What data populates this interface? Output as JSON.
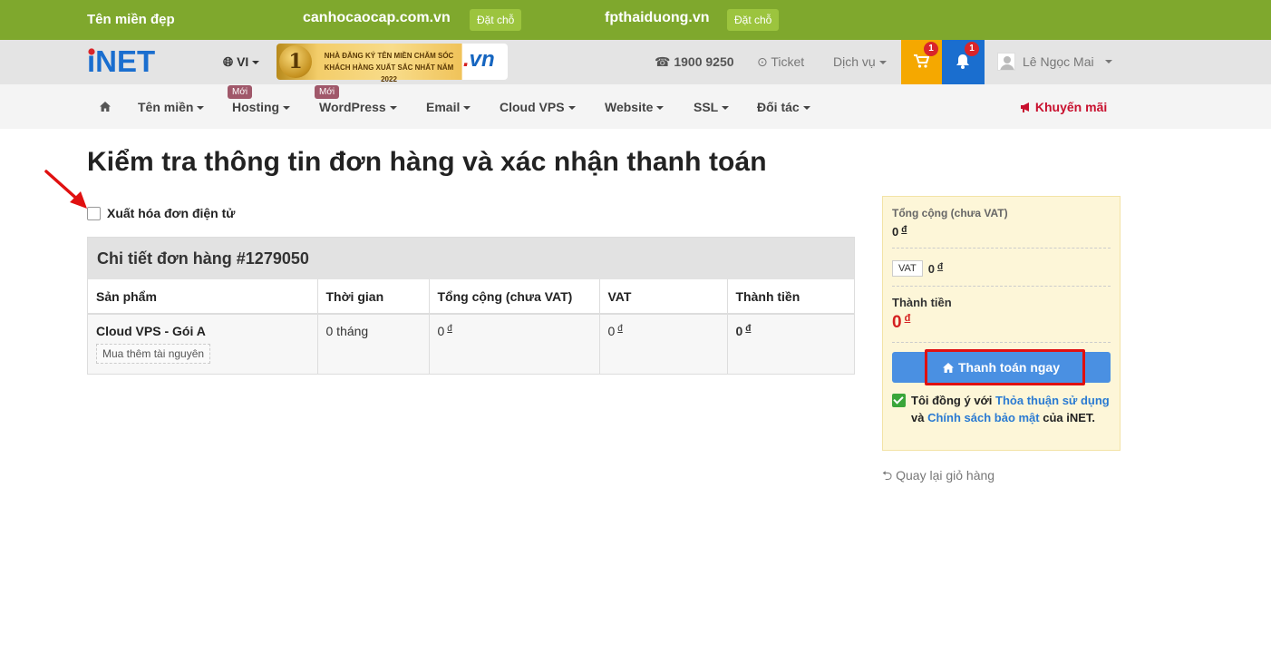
{
  "promo": {
    "title": "Tên miền đẹp",
    "domains": [
      {
        "name": "canhocaocap.com.vn",
        "button": "Đặt chỗ"
      },
      {
        "name": "fpthaiduong.vn",
        "button": "Đặt chỗ"
      }
    ]
  },
  "header": {
    "logo": "iNET",
    "language": "VI",
    "banner": {
      "rank": "1",
      "line1": "NHÀ ĐĂNG KÝ TÊN MIỀN CHĂM SÓC",
      "line2": "KHÁCH HÀNG XUẤT SẮC NHẤT NĂM 2022",
      "tld_dot": ".",
      "tld": "vn"
    },
    "hotline": "1900 9250",
    "ticket": "Ticket",
    "service": "Dịch vụ",
    "cart_count": "1",
    "notification_count": "1",
    "user_name": "Lê Ngọc Mai"
  },
  "nav": {
    "items": [
      {
        "label": "Tên miền"
      },
      {
        "label": "Hosting",
        "badge": "Mới"
      },
      {
        "label": "WordPress",
        "badge": "Mới"
      },
      {
        "label": "Email"
      },
      {
        "label": "Cloud VPS"
      },
      {
        "label": "Website"
      },
      {
        "label": "SSL"
      },
      {
        "label": "Đối tác"
      }
    ],
    "promotion": "Khuyến mãi"
  },
  "page": {
    "title": "Kiểm tra thông tin đơn hàng và xác nhận thanh toán",
    "invoice_label": "Xuất hóa đơn điện tử"
  },
  "order": {
    "heading": "Chi tiết đơn hàng #1279050",
    "columns": [
      "Sản phẩm",
      "Thời gian",
      "Tổng cộng (chưa VAT)",
      "VAT",
      "Thành tiền"
    ],
    "rows": [
      {
        "product": "Cloud VPS - Gói A",
        "addon": "Mua thêm tài nguyên",
        "duration": "0 tháng",
        "subtotal": "0",
        "vat": "0",
        "total": "0"
      }
    ],
    "currency": "đ"
  },
  "summary": {
    "subtotal_label": "Tổng cộng (chưa VAT)",
    "subtotal_value": "0",
    "vat_label": "VAT",
    "vat_value": "0",
    "total_label": "Thành tiền",
    "total_value": "0",
    "currency": "đ",
    "pay_button": "Thanh toán ngay",
    "agree_prefix": "Tôi đồng ý với",
    "agree_terms": "Thỏa thuận sử dụng",
    "agree_and": "và",
    "agree_privacy": "Chính sách bảo mật",
    "agree_suffix": "của iNET."
  },
  "back_link": "Quay lại giỏ hàng",
  "colors": {
    "promo_bar": "#7fa82d",
    "cart": "#f5a800",
    "bell": "#1a6ecf",
    "pay_button": "#4a90e2",
    "highlight": "#e01010",
    "price": "#d42020"
  }
}
